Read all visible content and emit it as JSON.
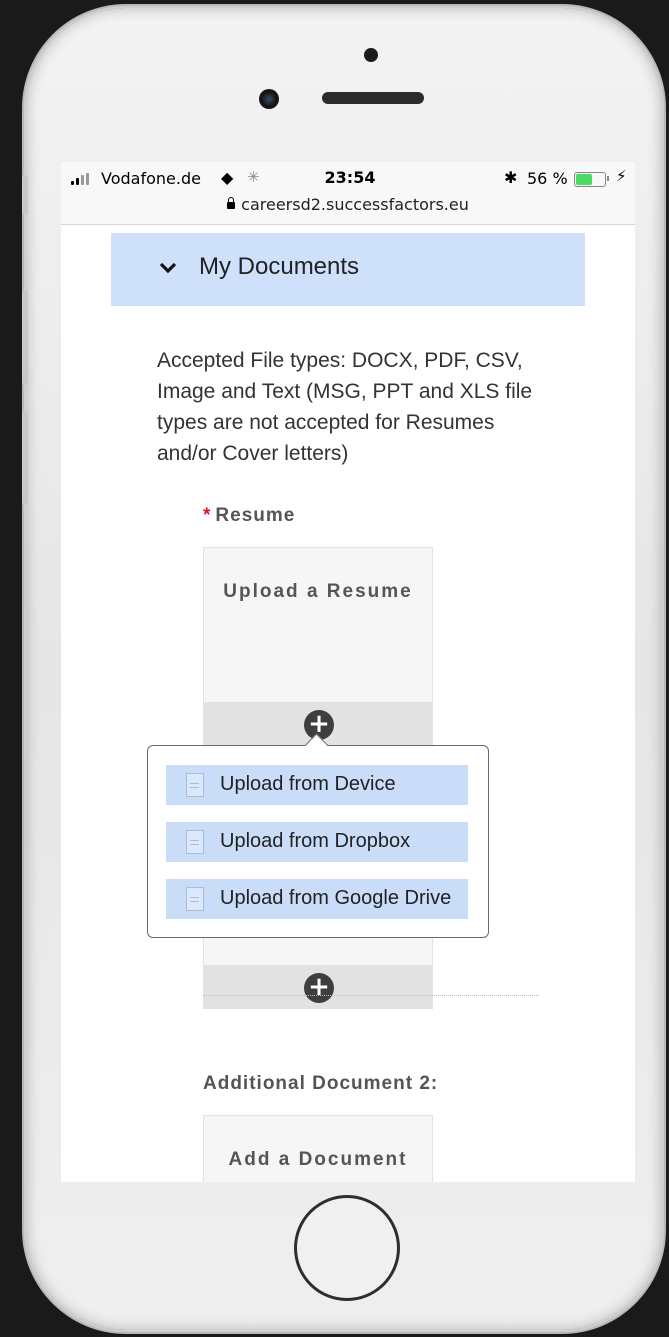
{
  "status": {
    "carrier": "Vodafone.de",
    "time": "23:54",
    "battery_percent": "56 %",
    "battery_level": 0.56,
    "url": "careersd2.successfactors.eu"
  },
  "section": {
    "title": "My Documents",
    "accepted_types": "Accepted File types: DOCX, PDF, CSV, Image and Text (MSG, PPT and XLS file types are not accepted for Resumes and/or Cover letters)"
  },
  "resume": {
    "required_marker": "*",
    "label": "Resume",
    "upload_text": "Upload a Resume"
  },
  "upload_menu": {
    "items": [
      {
        "label": "Upload from Device"
      },
      {
        "label": "Upload from Dropbox"
      },
      {
        "label": "Upload from Google Drive"
      }
    ]
  },
  "additional_doc": {
    "label": "Additional Document 2:",
    "upload_text": "Add a Document"
  },
  "icons": {
    "chevron": "chevron-down-icon",
    "add": "plus-icon",
    "document": "document-icon"
  },
  "colors": {
    "section_bg": "#cfe0fa",
    "menu_item_bg": "#c9ddf9",
    "required": "#dd1122",
    "battery": "#4cd964"
  }
}
